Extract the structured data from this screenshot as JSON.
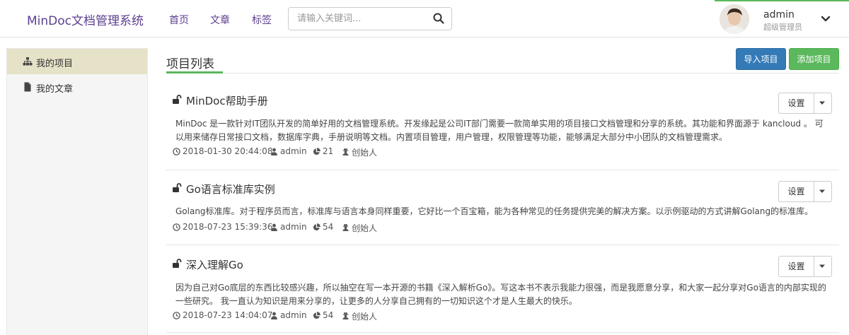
{
  "header": {
    "brand": "MinDoc文档管理系统",
    "nav": [
      "首页",
      "文章",
      "标签"
    ],
    "search_placeholder": "请输入关键词...",
    "user": {
      "name": "admin",
      "role": "超级管理员"
    }
  },
  "sidebar": {
    "items": [
      {
        "label": "我的项目",
        "icon": "sitemap-icon",
        "active": true
      },
      {
        "label": "我的文章",
        "icon": "file-icon",
        "active": false
      }
    ]
  },
  "main": {
    "title": "项目列表",
    "import_label": "导入项目",
    "add_label": "添加项目",
    "settings_label": "设置",
    "projects": [
      {
        "title": "MinDoc帮助手册",
        "description": "MinDoc 是一款针对IT团队开发的简单好用的文档管理系统。开发缘起是公司IT部门需要一款简单实用的项目接口文档管理和分享的系统。其功能和界面源于 kancloud 。 可以用来储存日常接口文档，数据库字典，手册说明等文档。内置项目管理，用户管理，权限管理等功能，能够满足大部分中小团队的文档管理需求。",
        "date": "2018-01-30 20:44:08",
        "author": "admin",
        "docs": "21",
        "role": "创始人"
      },
      {
        "title": "Go语言标准库实例",
        "description": "Golang标准库。对于程序员而言，标准库与语言本身同样重要，它好比一个百宝箱，能为各种常见的任务提供完美的解决方案。以示例驱动的方式讲解Golang的标准库。",
        "date": "2018-07-23 15:39:36",
        "author": "admin",
        "docs": "54",
        "role": "创始人"
      },
      {
        "title": "深入理解Go",
        "description": "因为自己对Go底层的东西比较感兴趣，所以抽空在写一本开源的书籍《深入解析Go》。写这本书不表示我能力很强，而是我愿意分享，和大家一起分享对Go语言的内部实现的一些研究。 我一直认为知识是用来分享的，让更多的人分享自己拥有的一切知识这个才是人生最大的快乐。",
        "date": "2018-07-23 14:04:07",
        "author": "admin",
        "docs": "54",
        "role": "创始人"
      }
    ]
  }
}
